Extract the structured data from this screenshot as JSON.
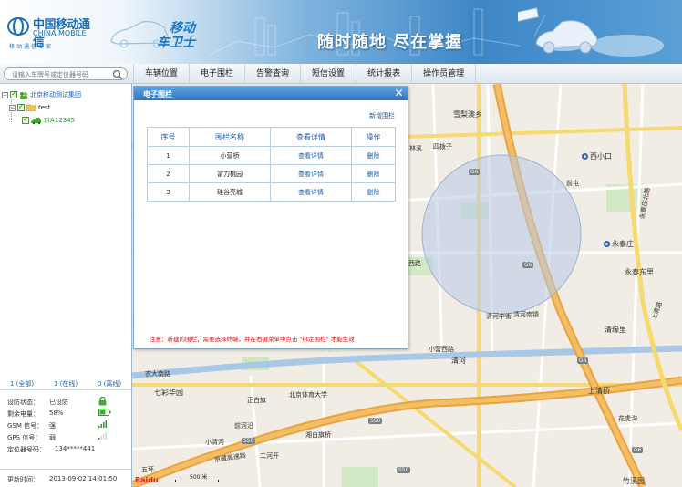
{
  "header": {
    "logo_cn": "中国移动通信",
    "logo_en": "CHINA MOBILE",
    "logo_tag": "移动通信专家",
    "brand_line1": "移动",
    "brand_line2": "车卫士",
    "slogan": "随时随地  尽在掌握"
  },
  "search": {
    "placeholder": "请输入车牌号或定位器号码"
  },
  "nav": {
    "tabs": [
      {
        "label": "车辆位置"
      },
      {
        "label": "电子围栏"
      },
      {
        "label": "告警查询"
      },
      {
        "label": "短信设置"
      },
      {
        "label": "统计报表"
      },
      {
        "label": "操作员管理"
      }
    ]
  },
  "tree": {
    "root": "北京移动测试集团",
    "group": "test",
    "vehicle": "京A12345"
  },
  "counts": {
    "all": "1 (全部)",
    "online": "1 (在线)",
    "offline": "0 (离线)"
  },
  "status": {
    "rows": [
      {
        "key": "设防状态：",
        "value": "已设防"
      },
      {
        "key": "剩余电量：",
        "value": "58%"
      },
      {
        "key": "GSM 信号：",
        "value": "强"
      },
      {
        "key": "GPS 信号：",
        "value": "弱"
      },
      {
        "key": "定位器号码：",
        "value": "134*****441"
      }
    ]
  },
  "updated": {
    "key": "更新时间：",
    "value": "2013-09-02 14:01:50"
  },
  "dialog": {
    "title": "电子围栏",
    "add_link": "新增围栏",
    "columns": [
      "序号",
      "围栏名称",
      "查看详情",
      "操作"
    ],
    "rows": [
      {
        "no": "1",
        "name": "小营桥",
        "detail": "查看详情",
        "action": "删除"
      },
      {
        "no": "2",
        "name": "富力桃园",
        "detail": "查看详情",
        "action": "删除"
      },
      {
        "no": "3",
        "name": "硅谷亮城",
        "detail": "查看详情",
        "action": "删除"
      }
    ],
    "note": "注意：新建的围栏，需要选择终端，并在右键菜单中点击 \"绑定围栏\" 才能生效"
  },
  "map": {
    "labels": [
      "雪梨澳乡",
      "西小口",
      "永泰庄",
      "永泰东里",
      "清缘里",
      "上清桥",
      "花虎沟",
      "竹溪园",
      "七彩华园",
      "农大南路",
      "北京体育大学",
      "正白旗",
      "前河沿",
      "二河开",
      "清河",
      "西路",
      "清河中街",
      "小营西路",
      "四拨子",
      "林溪",
      "京藏高速",
      "前屯",
      "清河南镇",
      "五环",
      "湘白旗桥",
      "小清河",
      "京藏高速路",
      "永泰庄北路",
      "上清路"
    ],
    "road_badges": [
      "G6",
      "G6",
      "G6",
      "G6",
      "S50",
      "S50",
      "S50"
    ],
    "scale": "500 米",
    "provider": "Baidu"
  },
  "colors": {
    "accent": "#2b78c2",
    "link": "#1a5fb4",
    "warning": "#dd1111",
    "online": "#1f9d1f",
    "fence_fill": "#b8c9e8"
  }
}
